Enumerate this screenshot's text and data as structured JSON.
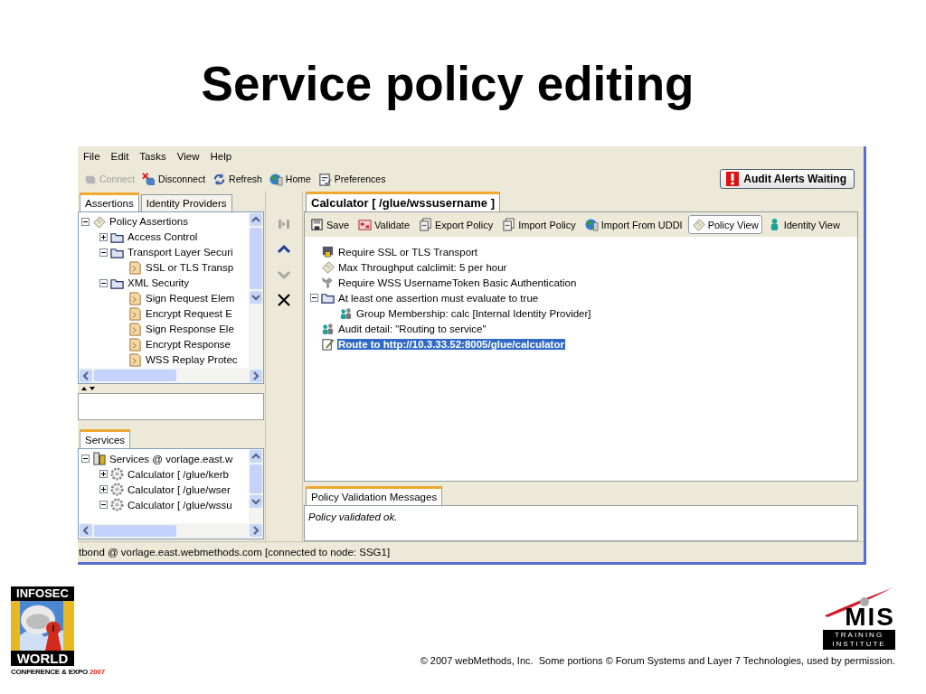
{
  "slide": {
    "title": "Service policy editing"
  },
  "menu_bar": [
    "File",
    "Edit",
    "Tasks",
    "View",
    "Help"
  ],
  "toolbar": {
    "buttons": [
      {
        "label": "Connect",
        "disabled": true
      },
      {
        "label": "Disconnect",
        "disabled": false
      },
      {
        "label": "Refresh",
        "disabled": false
      },
      {
        "label": "Home",
        "disabled": false
      },
      {
        "label": "Preferences",
        "disabled": false
      }
    ],
    "alert_button": "Audit Alerts Waiting"
  },
  "left_tabs": [
    {
      "label": "Assertions",
      "selected": true
    },
    {
      "label": "Identity Providers",
      "selected": false
    }
  ],
  "assertion_tree": [
    {
      "label": "Policy Assertions",
      "expanded": true,
      "children": [
        {
          "label": "Access Control",
          "expanded": false
        },
        {
          "label": "Transport Layer Securi",
          "expanded": true,
          "children": [
            {
              "label": "SSL or TLS Transp"
            }
          ]
        },
        {
          "label": "XML Security",
          "expanded": true,
          "children": [
            {
              "label": "Sign Request Elem"
            },
            {
              "label": "Encrypt Request E"
            },
            {
              "label": "Sign Response Ele"
            },
            {
              "label": "Encrypt Response"
            },
            {
              "label": "WSS Replay Protec"
            }
          ]
        }
      ]
    }
  ],
  "side_buttons": [
    {
      "disabled": true
    },
    {
      "disabled": false
    },
    {
      "disabled": true
    },
    {
      "disabled": false
    }
  ],
  "services_tab": {
    "label": "Services",
    "selected": true
  },
  "services_tree": [
    {
      "label": "Services @ vorlage.east.w",
      "expanded": true,
      "children": [
        {
          "label": "Calculator [ /glue/kerb",
          "expanded": false
        },
        {
          "label": "Calculator [ /glue/wser",
          "expanded": false
        },
        {
          "label": "Calculator [ /glue/wssu",
          "expanded": true
        }
      ]
    }
  ],
  "status_bar": "tbond @ vorlage.east.webmethods.com [connected to node: SSG1]",
  "editor_tab": {
    "label": "Calculator [ /glue/wssusername ]",
    "selected": true
  },
  "policy_toolbar": [
    {
      "label": "Save",
      "selected": false
    },
    {
      "label": "Validate",
      "selected": false
    },
    {
      "label": "Export Policy",
      "selected": false
    },
    {
      "label": "Import Policy",
      "selected": false
    },
    {
      "label": "Import From UDDI",
      "selected": false
    },
    {
      "label": "Policy View",
      "selected": true
    },
    {
      "label": "Identity View",
      "selected": false
    }
  ],
  "policy_tree": [
    {
      "label": "Require SSL or TLS Transport",
      "selected": false
    },
    {
      "label": "Max Throughput calclimit: 5 per hour",
      "selected": false
    },
    {
      "label": "Require WSS UsernameToken Basic Authentication",
      "selected": false
    },
    {
      "label": "At least one assertion must evaluate to true",
      "selected": false,
      "expanded": true,
      "children": [
        {
          "label": "Group Membership: calc [Internal Identity Provider]",
          "selected": false
        }
      ]
    },
    {
      "label": "Audit detail: \"Routing to service\"",
      "selected": false
    },
    {
      "label": "Route to http://10.3.33.52:8005/glue/calculator",
      "selected": true
    }
  ],
  "messages": {
    "tab": {
      "label": "Policy Validation Messages",
      "selected": true
    },
    "text": "Policy validated ok."
  },
  "footer": {
    "left_logo": {
      "top": "INFOSEC",
      "bottom": "WORLD",
      "tagline": "CONFERENCE & EXPO",
      "year": "2007"
    },
    "right_logo": {
      "name": "MIS",
      "lines": [
        "TRAINING",
        "INSTITUTE"
      ]
    },
    "copyright": "© 2007 webMethods, Inc.  Some portions © Forum Systems and Layer 7 Technologies, used by permission."
  }
}
